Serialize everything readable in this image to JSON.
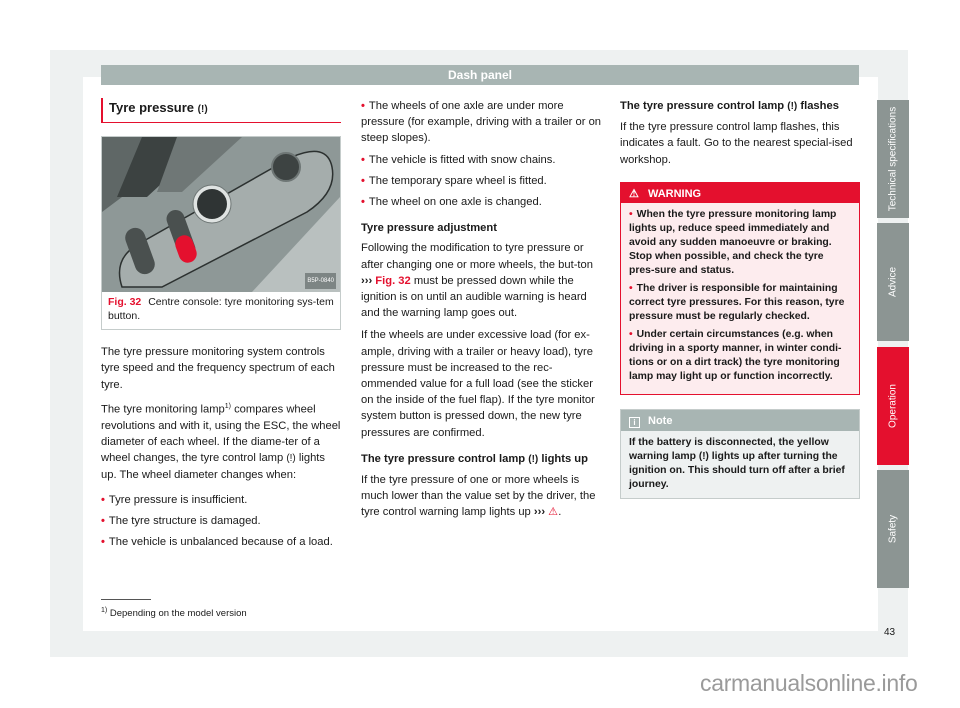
{
  "header": {
    "title": "Dash panel"
  },
  "section": {
    "title": "Tyre pressure",
    "title_icon": "(!)"
  },
  "figure": {
    "label": "Fig. 32",
    "caption": "Centre console: tyre monitoring sys-tem button.",
    "image_code": "B5P-0840"
  },
  "col1": {
    "p1": "The tyre pressure monitoring system controls tyre speed and the frequency spectrum of each tyre.",
    "p2_a": "The tyre monitoring lamp",
    "p2_sup": "1)",
    "p2_b": " compares wheel revolutions and with it, using the ESC, the wheel diameter of each wheel. If the diame-ter of a wheel changes, the tyre control lamp ",
    "p2_icon": "(!)",
    "p2_c": " lights up. The wheel diameter changes when:",
    "bullets": [
      "Tyre pressure is insufficient.",
      "The tyre structure is damaged.",
      "The vehicle is unbalanced because of a load."
    ]
  },
  "col2": {
    "bullets": [
      "The wheels of one axle are under more pressure (for example, driving with a trailer or on steep slopes).",
      "The vehicle is fitted with snow chains.",
      "The temporary spare wheel is fitted.",
      "The wheel on one axle is changed."
    ],
    "adjust_title": "Tyre pressure adjustment",
    "adjust_p1_a": "Following the modification to tyre pressure or after changing one or more wheels, the but-ton ",
    "adjust_p1_ref_arrow": "›››",
    "adjust_p1_ref": "Fig. 32",
    "adjust_p1_b": " must be pressed down while the ignition is on until an audible warning is heard and the warning lamp goes out.",
    "adjust_p2": "If the wheels are under excessive load (for ex-ample, driving with a trailer or heavy load), tyre pressure must be increased to the rec-ommended value for a full load (see the sticker on the inside of the fuel flap). If the tyre monitor system button is pressed down, the new tyre pressures are confirmed.",
    "lights_title_a": "The tyre pressure control lamp ",
    "lights_title_icon": "(!)",
    "lights_title_b": " lights up",
    "lights_p_a": "If the tyre pressure of one or more wheels is much lower than the value set by the driver, the tyre control warning lamp lights up ",
    "lights_p_arrow": "›››",
    "lights_p_warn": "⚠",
    "lights_p_end": "."
  },
  "col3": {
    "flash_title_a": "The tyre pressure control lamp ",
    "flash_title_icon": "(!)",
    "flash_title_b": " flashes",
    "flash_p": "If the tyre pressure control lamp flashes, this indicates a fault. Go to the nearest special-ised workshop.",
    "warning": {
      "icon": "⚠",
      "label": "WARNING",
      "bullets": [
        "When the tyre pressure monitoring lamp lights up, reduce speed immediately and avoid any sudden manoeuvre or braking. Stop when possible, and check the tyre pres-sure and status.",
        "The driver is responsible for maintaining correct tyre pressures. For this reason, tyre pressure must be regularly checked.",
        "Under certain circumstances (e.g. when driving in a sporty manner, in winter condi-tions or on a dirt track) the tyre monitoring lamp may light up or function incorrectly."
      ]
    },
    "note": {
      "icon": "i",
      "label": "Note",
      "text_a": "If the battery is disconnected, the yellow warning lamp ",
      "text_icon": "(!)",
      "text_b": " lights up after turning the ignition on. This should turn off after a brief journey."
    }
  },
  "tabs": [
    {
      "label": "Technical specifications",
      "active": false
    },
    {
      "label": "Advice",
      "active": false
    },
    {
      "label": "Operation",
      "active": true
    },
    {
      "label": "Safety",
      "active": false
    }
  ],
  "footnote": {
    "marker": "1)",
    "text": "Depending on the model version"
  },
  "page_number": "43",
  "watermark": "carmanualsonline.info",
  "colors": {
    "accent": "#e4102e",
    "header_gray": "#a8b5b3",
    "tab_gray": "#8c9593"
  }
}
